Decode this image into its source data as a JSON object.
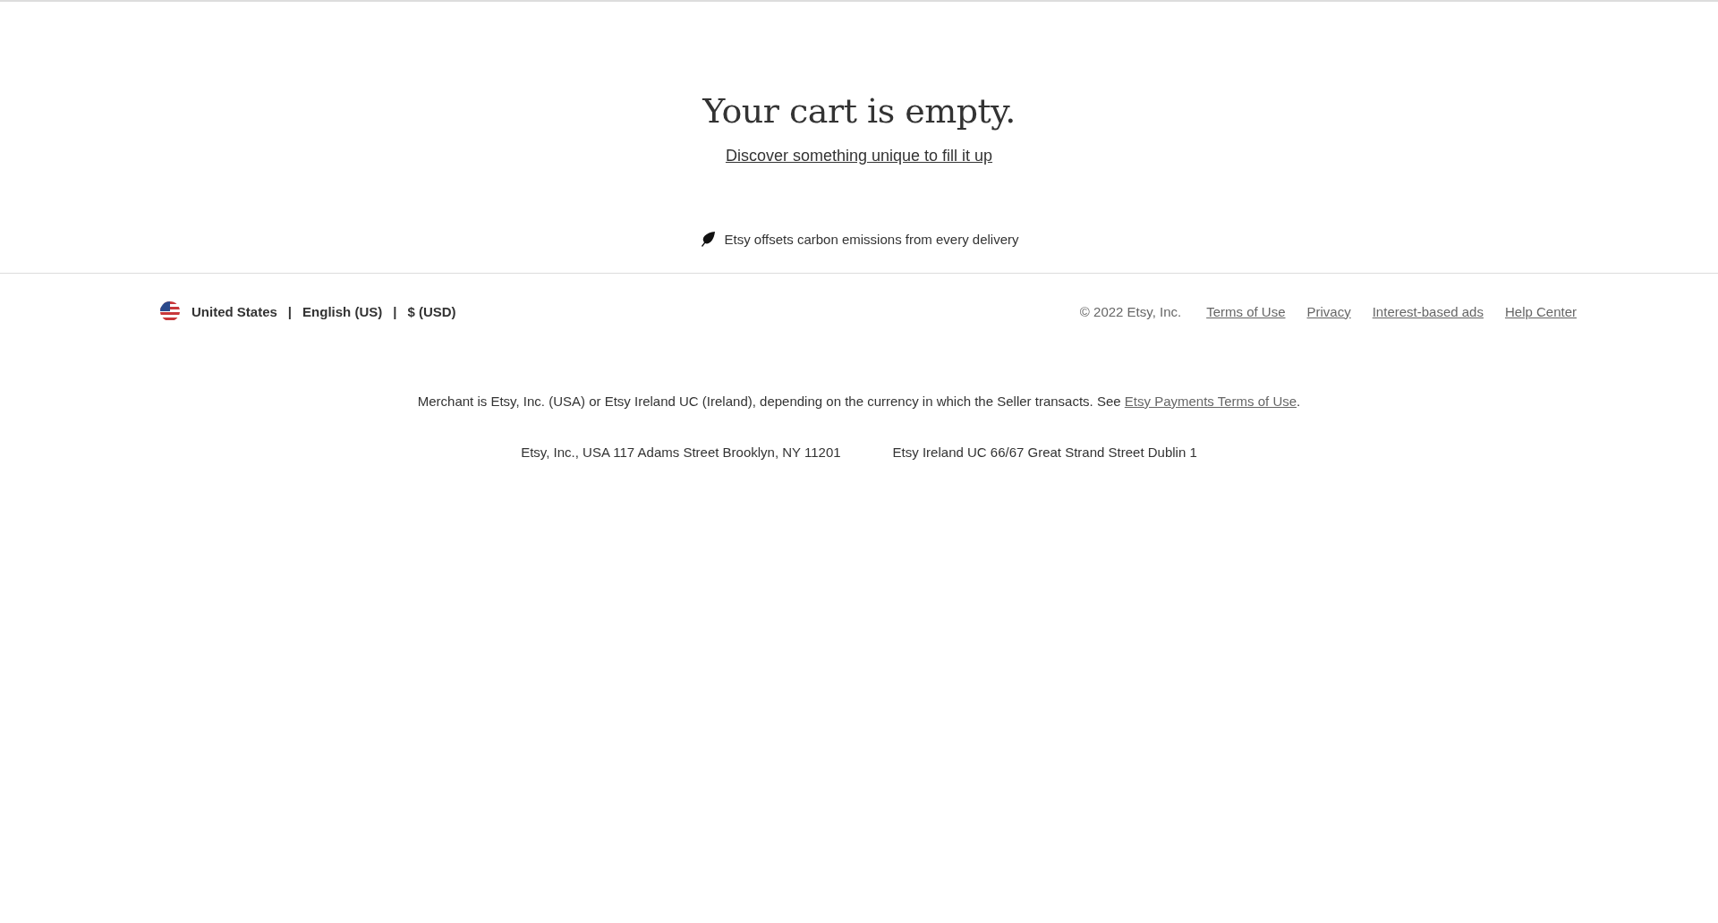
{
  "cart": {
    "heading": "Your cart is empty.",
    "discover_link": "Discover something unique to fill it up",
    "carbon_note": "Etsy offsets carbon emissions from every delivery"
  },
  "footer": {
    "region": "United States",
    "separator_1": "|",
    "language": "English (US)",
    "separator_2": "|",
    "currency": "$ (USD)",
    "copyright": "© 2022 Etsy, Inc.",
    "links": [
      "Terms of Use",
      "Privacy",
      "Interest-based ads",
      "Help Center"
    ],
    "merchant": {
      "text": "Merchant is Etsy, Inc. (USA) or Etsy Ireland UC (Ireland), depending on the currency in which the Seller transacts. See ",
      "link": "Etsy Payments Terms of Use",
      "after": "."
    },
    "addresses": [
      "Etsy, Inc., USA 117 Adams Street Brooklyn, NY 11201",
      "Etsy Ireland UC 66/67 Great Strand Street Dublin 1"
    ]
  }
}
